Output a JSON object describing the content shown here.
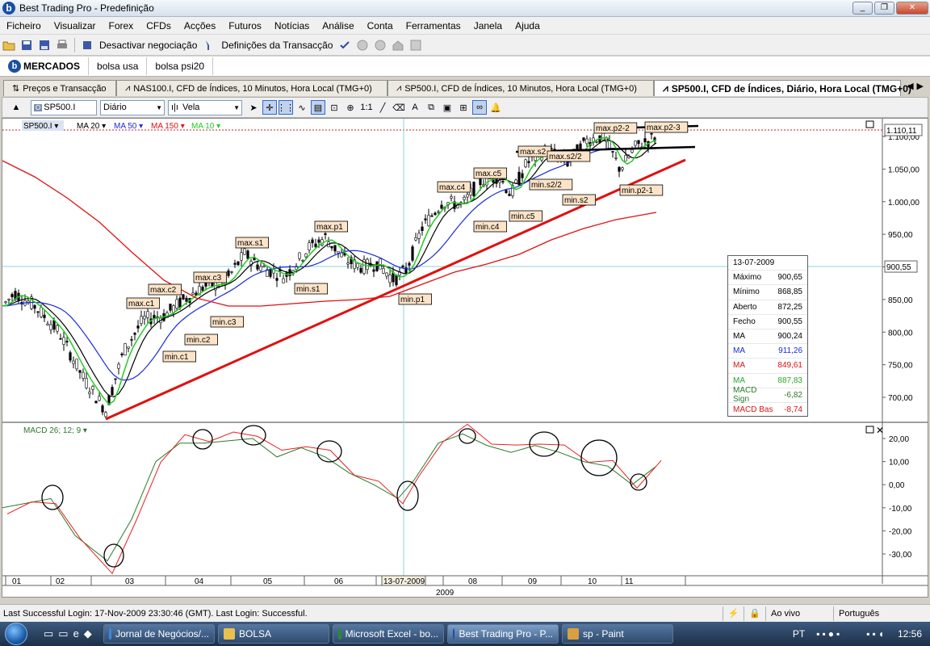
{
  "window": {
    "title": "Best Trading Pro - Predefinição",
    "buttons": [
      "_",
      "❐",
      "✕"
    ]
  },
  "menu": [
    "Ficheiro",
    "Visualizar",
    "Forex",
    "CFDs",
    "Acções",
    "Futuros",
    "Notícias",
    "Análise",
    "Conta",
    "Ferramentas",
    "Janela",
    "Ajuda"
  ],
  "toolbar": {
    "deactivate": "Desactivar negociação",
    "transaction_settings": "Definições da Transacção"
  },
  "market_tabs": [
    "MERCADOS",
    "bolsa usa",
    "bolsa psi20"
  ],
  "doc_tabs": [
    "Preços e Transacção",
    "NAS100.I, CFD de Índices, 10 Minutos, Hora Local (TMG+0)",
    "SP500.I, CFD de Índices, 10 Minutos, Hora Local (TMG+0)",
    "SP500.I, CFD de Índices, Diário, Hora Local (TMG+0)"
  ],
  "chart_toolbar": {
    "symbol": "SP500.I",
    "period": "Diário",
    "style": "Vela"
  },
  "legend": {
    "symbol": "SP500.I",
    "ma20": "MA 20",
    "ma50": "MA 50",
    "ma150": "MA 150",
    "ma10": "MA 10",
    "macd": "MACD 26; 12; 9"
  },
  "colors": {
    "ma20": "#000000",
    "ma50": "#1a2bd8",
    "ma150": "#e01010",
    "ma10": "#22cc22",
    "trendline": "#e01010",
    "macd_signal": "#2a7a2a",
    "macd_base": "#e82020",
    "annotation_bg": "#fde4c8"
  },
  "price_axis": {
    "ticks": [
      "1.100,00",
      "1.050,00",
      "1.000,00",
      "950,00",
      "900,00",
      "850,00",
      "800,00",
      "750,00",
      "700,00"
    ],
    "high_marker": "1.110,11",
    "cursor_marker": "900,55"
  },
  "macd_axis": {
    "ticks": [
      "20,00",
      "10,00",
      "0,00",
      "-10,00",
      "-20,00",
      "-30,00"
    ]
  },
  "time_axis": {
    "months": [
      "01",
      "02",
      "03",
      "04",
      "05",
      "06",
      "08",
      "09",
      "10",
      "11"
    ],
    "cursor_date": "13-07-2009",
    "year": "2009"
  },
  "annotations": [
    {
      "label": "max.c1"
    },
    {
      "label": "max.c2"
    },
    {
      "label": "max.c3"
    },
    {
      "label": "max.s1"
    },
    {
      "label": "max.p1"
    },
    {
      "label": "max.c4"
    },
    {
      "label": "max.c5"
    },
    {
      "label": "max.s2"
    },
    {
      "label": "max.s2/2"
    },
    {
      "label": "max.p2-2"
    },
    {
      "label": "max.p2-3"
    },
    {
      "label": "min.c1"
    },
    {
      "label": "min.c2"
    },
    {
      "label": "min.c3"
    },
    {
      "label": "min.s1"
    },
    {
      "label": "min.p1"
    },
    {
      "label": "min.c4"
    },
    {
      "label": "min.c5"
    },
    {
      "label": "min.s2/2"
    },
    {
      "label": "min.s2"
    },
    {
      "label": "min.p2-1"
    }
  ],
  "data_window": {
    "date": "13-07-2009",
    "rows": [
      {
        "k": "Máximo",
        "v": "900,65",
        "color": "#000000"
      },
      {
        "k": "Mínimo",
        "v": "868,85",
        "color": "#000000"
      },
      {
        "k": "Aberto",
        "v": "872,25",
        "color": "#000000"
      },
      {
        "k": "Fecho",
        "v": "900,55",
        "color": "#000000"
      },
      {
        "k": "MA",
        "v": "900,24",
        "color": "#000000"
      },
      {
        "k": "MA",
        "v": "911,26",
        "color": "#1a2bd8"
      },
      {
        "k": "MA",
        "v": "849,61",
        "color": "#e01010"
      },
      {
        "k": "MA",
        "v": "887,83",
        "color": "#22aa22"
      },
      {
        "k": "MACD Sign",
        "v": "-6,82",
        "color": "#2a7a2a"
      },
      {
        "k": "MACD Bas",
        "v": "-8,74",
        "color": "#e01010"
      }
    ]
  },
  "status": {
    "message": "Last Successful Login: 17-Nov-2009 23:30:46 (GMT). Last Login: Successful.",
    "live": "Ao vivo",
    "language": "Português"
  },
  "taskbar": {
    "items": [
      "Jornal de Negócios/...",
      "BOLSA",
      "Microsoft Excel - bo...",
      "Best Trading Pro - P...",
      "sp - Paint"
    ],
    "lang": "PT",
    "clock": "12:56"
  }
}
